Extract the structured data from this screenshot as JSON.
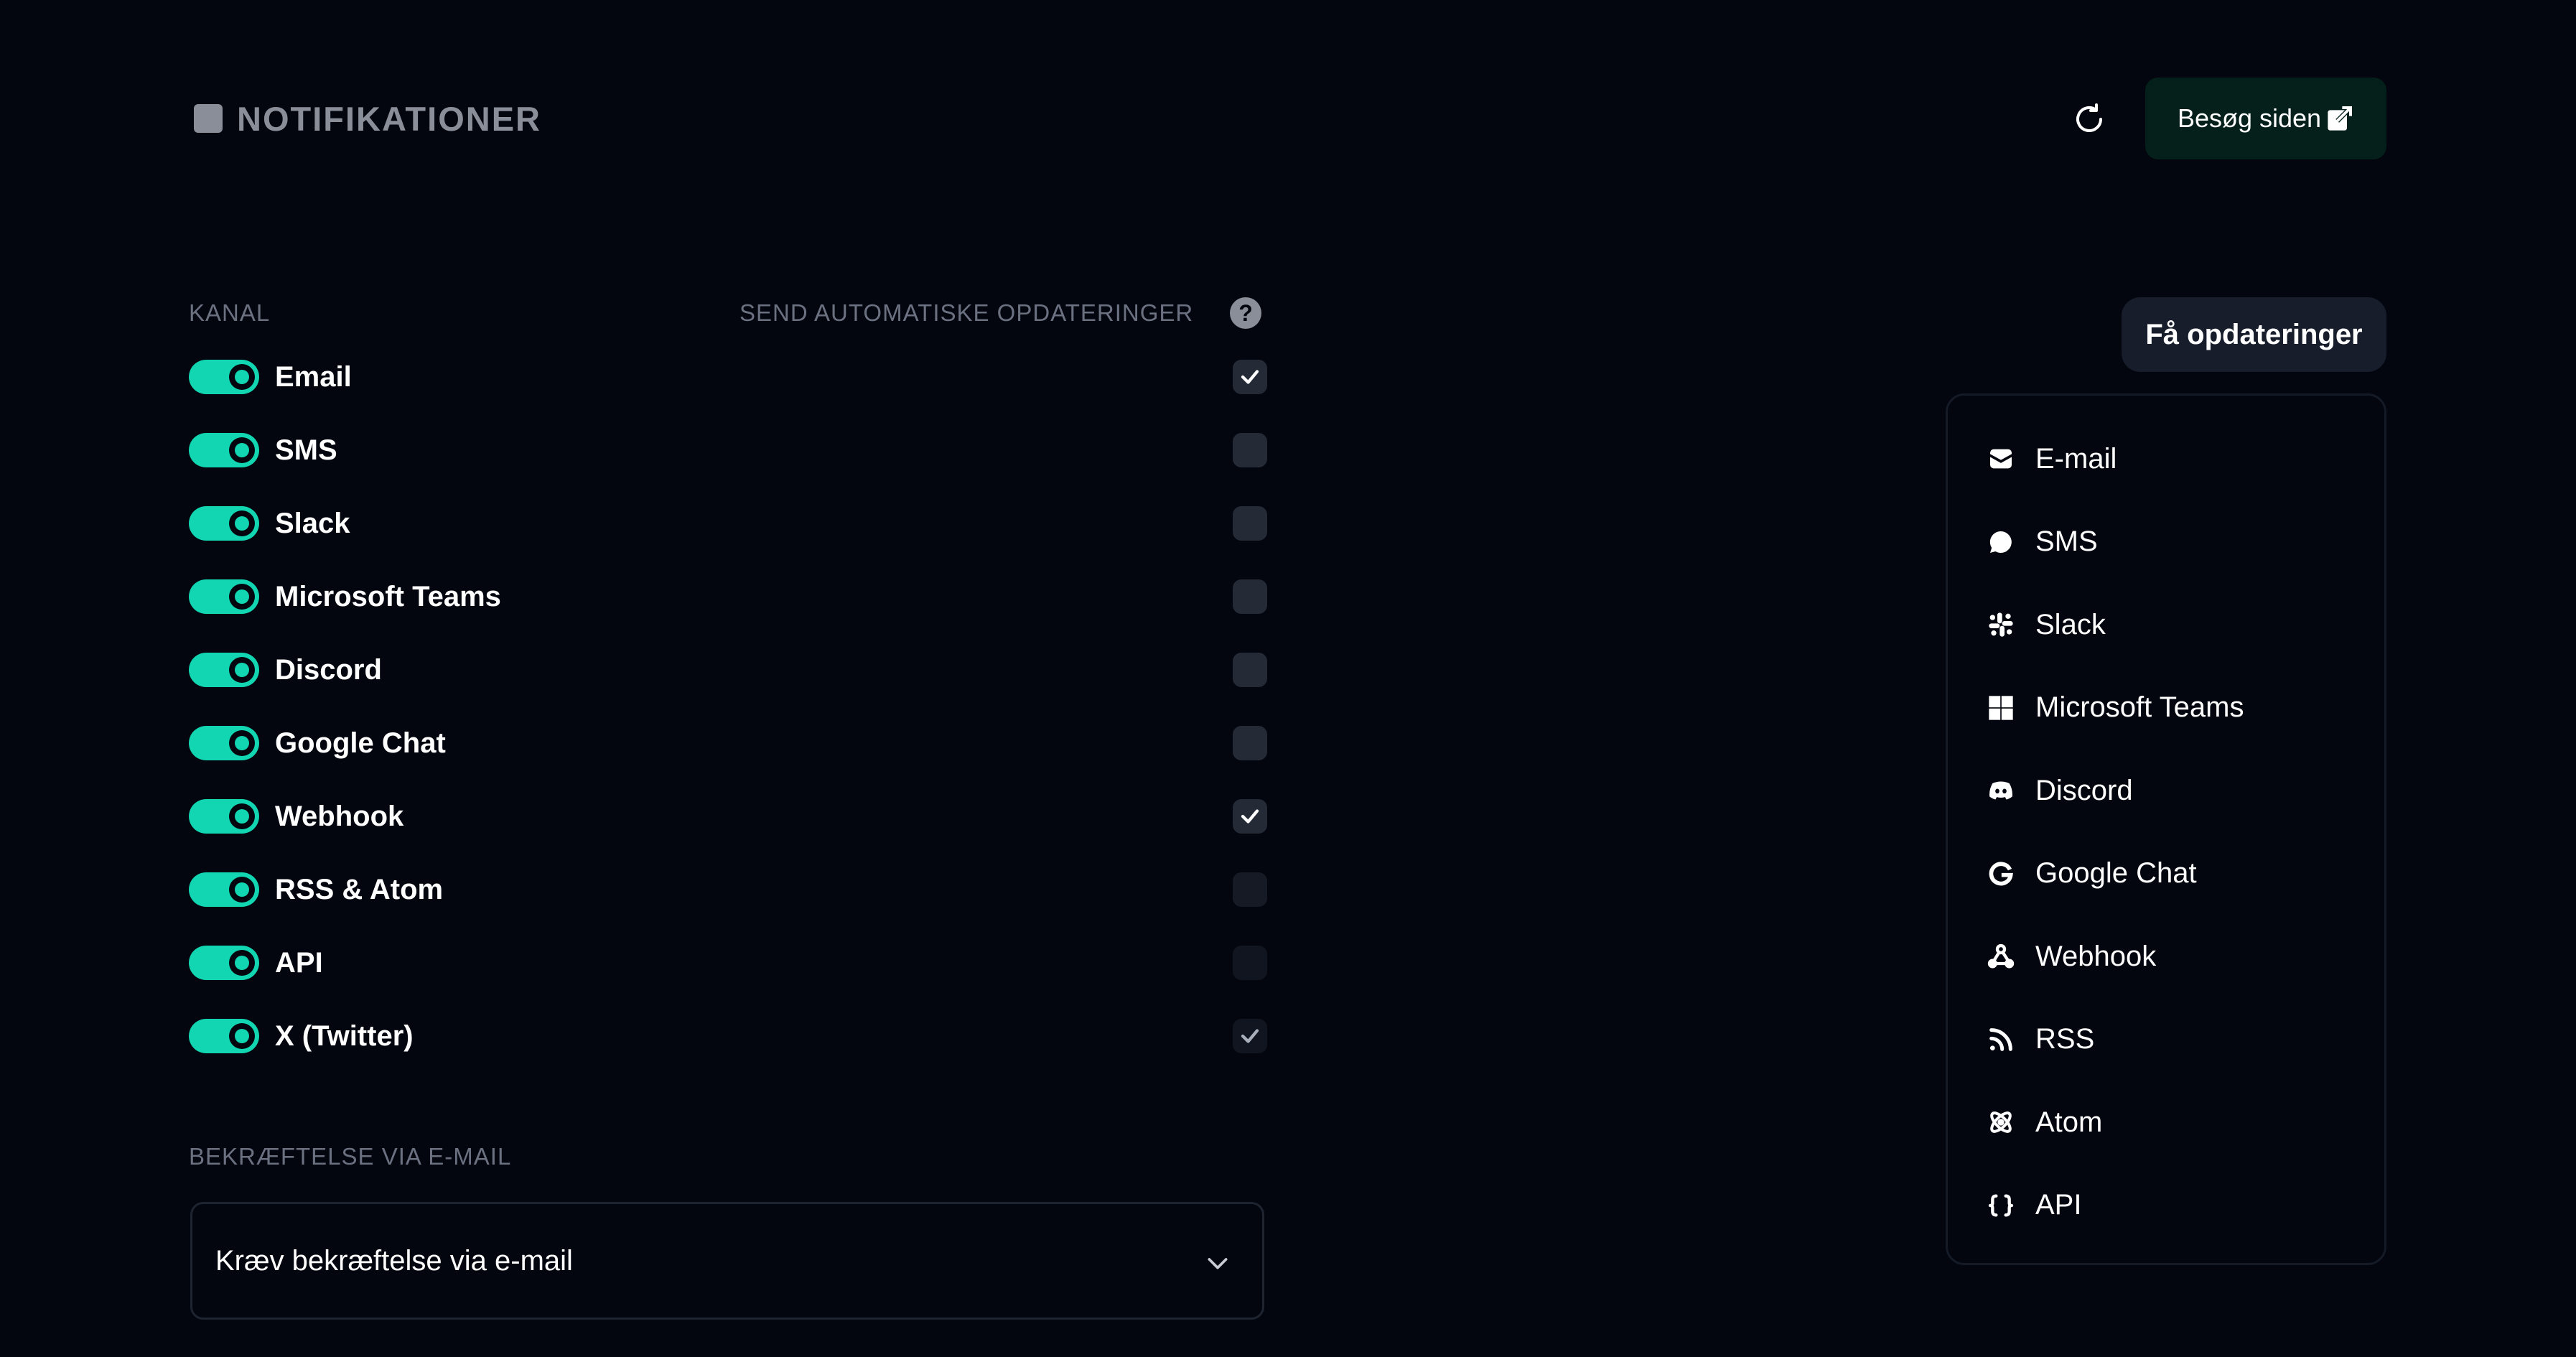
{
  "header": {
    "title": "NOTIFIKATIONER",
    "visit_label": "Besøg siden"
  },
  "channels": {
    "column_channel": "KANAL",
    "column_auto": "SEND AUTOMATISKE OPDATERINGER",
    "items": [
      {
        "label": "Email",
        "enabled": true,
        "auto": true
      },
      {
        "label": "SMS",
        "enabled": true,
        "auto": false
      },
      {
        "label": "Slack",
        "enabled": true,
        "auto": false
      },
      {
        "label": "Microsoft Teams",
        "enabled": true,
        "auto": false
      },
      {
        "label": "Discord",
        "enabled": true,
        "auto": false
      },
      {
        "label": "Google Chat",
        "enabled": true,
        "auto": false
      },
      {
        "label": "Webhook",
        "enabled": true,
        "auto": true
      },
      {
        "label": "RSS & Atom",
        "enabled": true,
        "auto": false
      },
      {
        "label": "API",
        "enabled": true,
        "auto": false
      },
      {
        "label": "X (Twitter)",
        "enabled": true,
        "auto": true
      }
    ]
  },
  "confirmation": {
    "header": "BEKRÆFTELSE VIA E-MAIL",
    "selected": "Kræv bekræftelse via e-mail"
  },
  "updates": {
    "button_label": "Få opdateringer",
    "menu": [
      {
        "label": "E-mail",
        "icon": "envelope-icon"
      },
      {
        "label": "SMS",
        "icon": "chat-bubble-icon"
      },
      {
        "label": "Slack",
        "icon": "slack-icon"
      },
      {
        "label": "Microsoft Teams",
        "icon": "windows-icon"
      },
      {
        "label": "Discord",
        "icon": "discord-icon"
      },
      {
        "label": "Google Chat",
        "icon": "google-icon"
      },
      {
        "label": "Webhook",
        "icon": "webhook-icon"
      },
      {
        "label": "RSS",
        "icon": "rss-icon"
      },
      {
        "label": "Atom",
        "icon": "atom-icon"
      },
      {
        "label": "API",
        "icon": "braces-icon"
      }
    ]
  },
  "colors": {
    "background": "#03060f",
    "accent": "#12d6b1",
    "muted_text": "#6b7180"
  }
}
